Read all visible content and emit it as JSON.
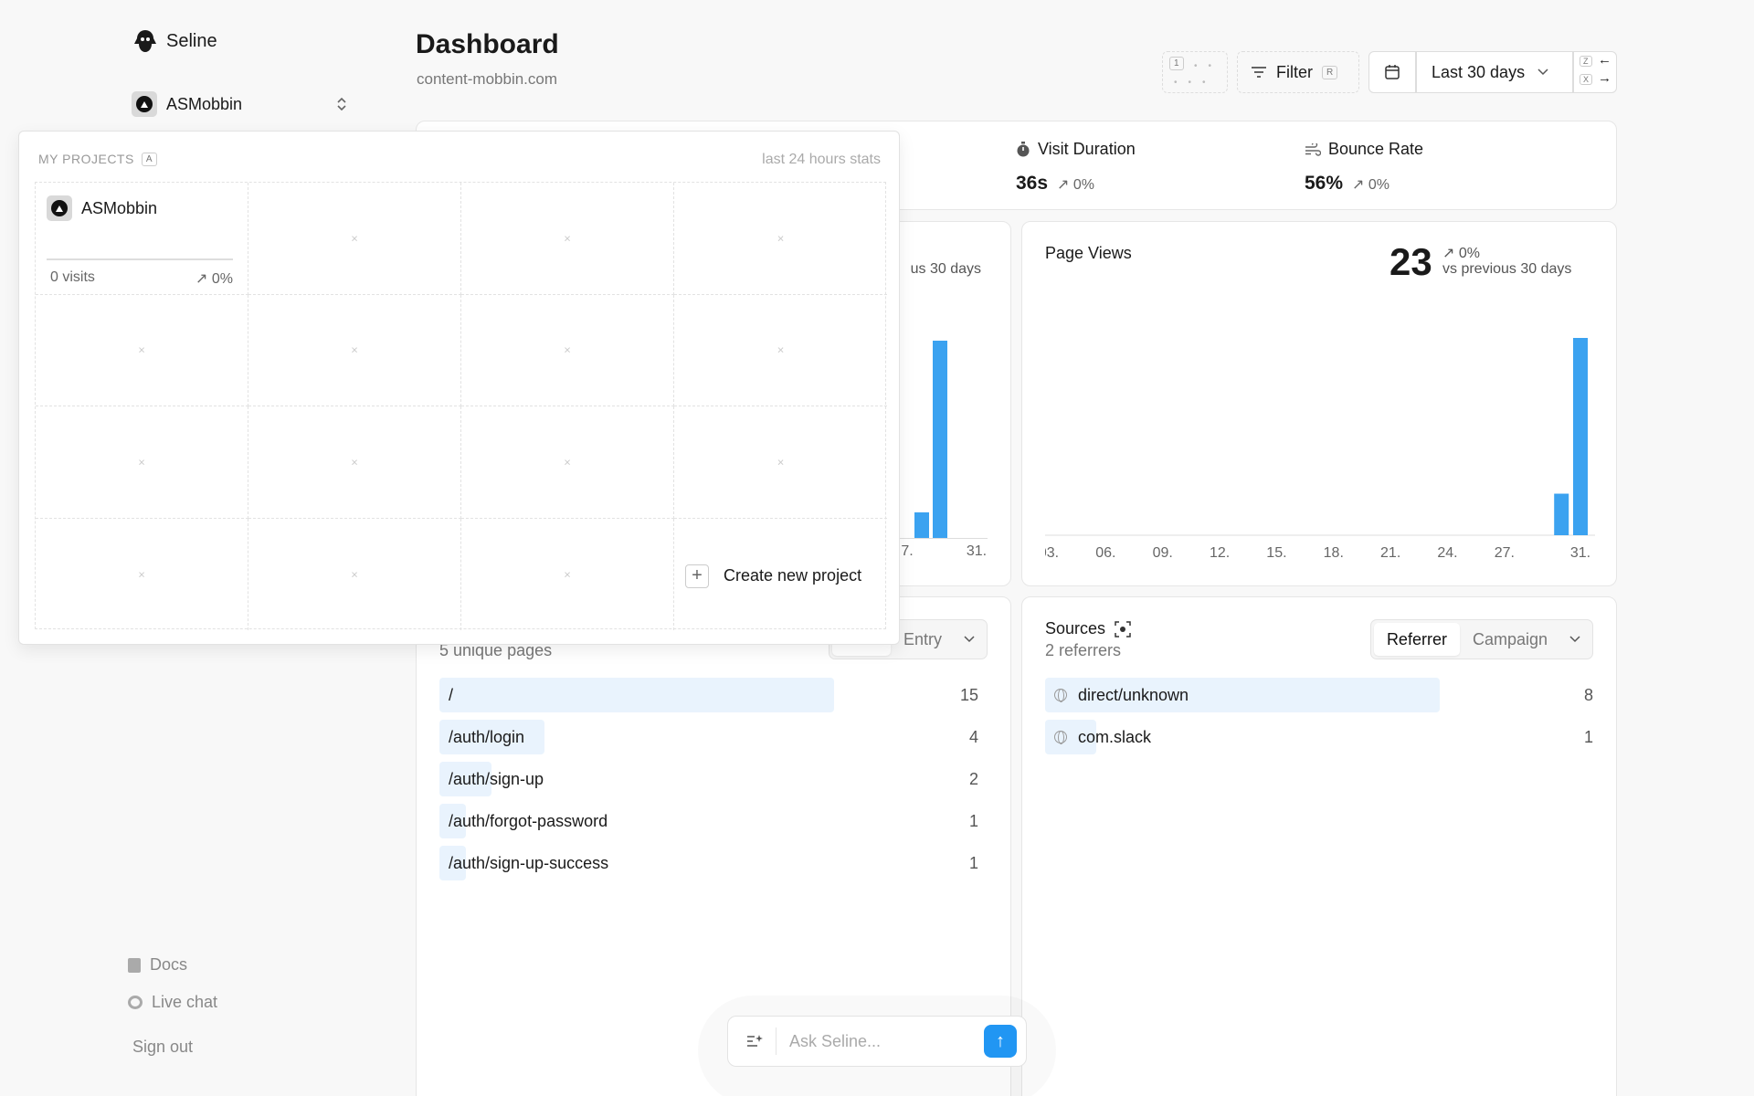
{
  "brand": {
    "name": "Seline"
  },
  "sidebar": {
    "project_name": "ASMobbin",
    "docs_label": "Docs",
    "live_chat_label": "Live chat",
    "signout_label": "Sign out"
  },
  "header": {
    "title": "Dashboard",
    "domain": "content-mobbin.com",
    "shortcut_1": "1",
    "filter_label": "Filter",
    "filter_key": "R",
    "range_label": "Last 30 days",
    "prev_key": "Z",
    "next_key": "X"
  },
  "stats": [
    {
      "label": "Visit Duration",
      "value": "36s",
      "change": "0%",
      "icon": "stopwatch-icon"
    },
    {
      "label": "Bounce Rate",
      "value": "56%",
      "change": "0%",
      "icon": "wind-icon"
    }
  ],
  "visitors_chart": {
    "compare_text": "us 30 days",
    "ticks": [
      "7.",
      "31."
    ]
  },
  "page_views": {
    "title": "Page Views",
    "total": "23",
    "change": "0%",
    "compare_text": "vs previous 30 days"
  },
  "chart_data": {
    "type": "bar",
    "title": "Page Views",
    "categories": [
      "03.",
      "06.",
      "09.",
      "12.",
      "15.",
      "18.",
      "21.",
      "24.",
      "27.",
      "31."
    ],
    "x": [
      3,
      4,
      5,
      6,
      7,
      8,
      9,
      10,
      11,
      12,
      13,
      14,
      15,
      16,
      17,
      18,
      19,
      20,
      21,
      22,
      23,
      24,
      25,
      26,
      27,
      28,
      29,
      30,
      31
    ],
    "values": [
      0,
      0,
      0,
      0,
      0,
      0,
      0,
      0,
      0,
      0,
      0,
      0,
      0,
      0,
      0,
      0,
      0,
      0,
      0,
      0,
      0,
      0,
      0,
      0,
      0,
      0,
      0,
      4,
      19
    ],
    "ylim": [
      0,
      19
    ],
    "grid": false
  },
  "pages_panel": {
    "subtitle": "5 unique pages",
    "tab_entry": "Entry",
    "rows": [
      {
        "path": "/",
        "count": "15",
        "share": 1.0
      },
      {
        "path": "/auth/login",
        "count": "4",
        "share": 0.267
      },
      {
        "path": "/auth/sign-up",
        "count": "2",
        "share": 0.133
      },
      {
        "path": "/auth/forgot-password",
        "count": "1",
        "share": 0.067
      },
      {
        "path": "/auth/sign-up-success",
        "count": "1",
        "share": 0.067
      }
    ]
  },
  "sources_panel": {
    "title": "Sources",
    "subtitle": "2 referrers",
    "tab_referrer": "Referrer",
    "tab_campaign": "Campaign",
    "rows": [
      {
        "name": "direct/unknown",
        "count": "8",
        "share": 1.0
      },
      {
        "name": "com.slack",
        "count": "1",
        "share": 0.125
      }
    ]
  },
  "projects_popup": {
    "heading": "MY PROJECTS",
    "heading_key": "A",
    "stats_label": "last 24 hours stats",
    "project_name": "ASMobbin",
    "visits": "0 visits",
    "change": "0%",
    "create_label": "Create new project",
    "empty_mark": "×"
  },
  "chat": {
    "placeholder": "Ask Seline..."
  }
}
